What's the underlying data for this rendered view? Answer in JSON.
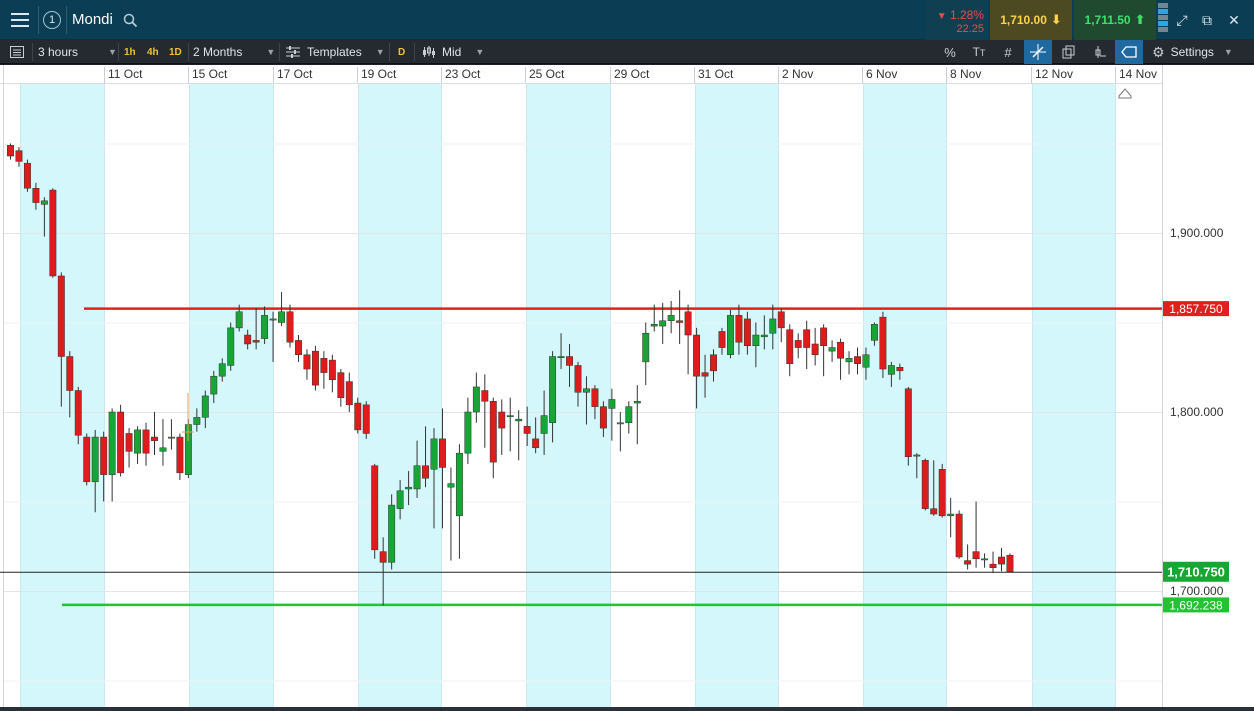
{
  "header": {
    "window_number": "1",
    "instrument": "Mondi",
    "change_percent": "1.28%",
    "change_abs": "22.25",
    "sell_price": "1,710.00",
    "buy_price": "1,711.50"
  },
  "toolbar": {
    "interval": "3 hours",
    "q1": "1h",
    "q2": "4h",
    "q3": "1D",
    "range": "2 Months",
    "templates": "Templates",
    "d_badge": "D",
    "price_type": "Mid",
    "settings": "Settings"
  },
  "colors": {
    "up": "#17a536",
    "down": "#e01b1b",
    "resistance": "#e02020",
    "support": "#22c233",
    "band": "#d4f7fb",
    "last_price_bg": "#18a632"
  },
  "chart_data": {
    "type": "candlestick",
    "x_labels": [
      "11 Oct",
      "15 Oct",
      "17 Oct",
      "19 Oct",
      "23 Oct",
      "25 Oct",
      "29 Oct",
      "31 Oct",
      "2 Nov",
      "6 Nov",
      "8 Nov",
      "12 Nov",
      "14 Nov"
    ],
    "y_ticks": [
      "1,900.000",
      "1,800.000",
      "1,700.000"
    ],
    "y_tick_values": [
      1900,
      1800,
      1700
    ],
    "ylim": [
      1650,
      1985
    ],
    "resistance": {
      "value": 1857.75,
      "label": "1,857.750"
    },
    "support": {
      "value": 1692.238,
      "label": "1,692.238"
    },
    "last_price": {
      "value": 1710.75,
      "label": "1,710.750"
    },
    "candles": [
      [
        1949,
        1943,
        1950,
        1941
      ],
      [
        1946,
        1940,
        1948,
        1937
      ],
      [
        1939,
        1925,
        1941,
        1923
      ],
      [
        1925,
        1917,
        1928,
        1913
      ],
      [
        1916,
        1918,
        1920,
        1898
      ],
      [
        1924,
        1876,
        1925,
        1875
      ],
      [
        1876,
        1831,
        1878,
        1803
      ],
      [
        1831,
        1812,
        1834,
        1797
      ],
      [
        1812,
        1787,
        1814,
        1782
      ],
      [
        1786,
        1761,
        1788,
        1759
      ],
      [
        1761,
        1786,
        1790,
        1744
      ],
      [
        1786,
        1765,
        1789,
        1750
      ],
      [
        1765,
        1800,
        1802,
        1750
      ],
      [
        1800,
        1766,
        1804,
        1764
      ],
      [
        1788,
        1778,
        1791,
        1769
      ],
      [
        1777,
        1790,
        1792,
        1771
      ],
      [
        1790,
        1777,
        1794,
        1770
      ],
      [
        1786,
        1784,
        1800,
        1776
      ],
      [
        1778,
        1780,
        1796,
        1770
      ],
      [
        1786,
        1786,
        1796,
        1779
      ],
      [
        1786,
        1766,
        1788,
        1762
      ],
      [
        1765,
        1793,
        1796,
        1763
      ],
      [
        1793,
        1797,
        1802,
        1789
      ],
      [
        1797,
        1809,
        1812,
        1791
      ],
      [
        1810,
        1820,
        1823,
        1805
      ],
      [
        1820,
        1827,
        1830,
        1817
      ],
      [
        1826,
        1847,
        1850,
        1823
      ],
      [
        1847,
        1856,
        1860,
        1845
      ],
      [
        1843,
        1838,
        1846,
        1835
      ],
      [
        1840,
        1839,
        1858,
        1835
      ],
      [
        1841,
        1854,
        1859,
        1838
      ],
      [
        1852,
        1852,
        1856,
        1828
      ],
      [
        1850,
        1856,
        1867,
        1848
      ],
      [
        1856,
        1839,
        1860,
        1836
      ],
      [
        1840,
        1832,
        1843,
        1828
      ],
      [
        1832,
        1824,
        1835,
        1818
      ],
      [
        1834,
        1815,
        1837,
        1812
      ],
      [
        1830,
        1822,
        1834,
        1813
      ],
      [
        1829,
        1818,
        1832,
        1811
      ],
      [
        1822,
        1808,
        1824,
        1803
      ],
      [
        1817,
        1804,
        1822,
        1800
      ],
      [
        1805,
        1790,
        1808,
        1788
      ],
      [
        1804,
        1788,
        1806,
        1785
      ],
      [
        1770,
        1723,
        1771,
        1718
      ],
      [
        1722,
        1716,
        1730,
        1692
      ],
      [
        1716,
        1748,
        1754,
        1712
      ],
      [
        1746,
        1756,
        1762,
        1740
      ],
      [
        1757,
        1758,
        1767,
        1748
      ],
      [
        1757,
        1770,
        1784,
        1752
      ],
      [
        1770,
        1763,
        1792,
        1758
      ],
      [
        1768,
        1785,
        1791,
        1735
      ],
      [
        1785,
        1769,
        1802,
        1735
      ],
      [
        1758,
        1760,
        1769,
        1717
      ],
      [
        1742,
        1777,
        1782,
        1718
      ],
      [
        1777,
        1800,
        1808,
        1771
      ],
      [
        1800,
        1814,
        1822,
        1794
      ],
      [
        1812,
        1806,
        1821,
        1780
      ],
      [
        1806,
        1772,
        1808,
        1763
      ],
      [
        1800,
        1791,
        1807,
        1776
      ],
      [
        1798,
        1798,
        1808,
        1778
      ],
      [
        1795,
        1796,
        1801,
        1773
      ],
      [
        1792,
        1788,
        1803,
        1781
      ],
      [
        1785,
        1780,
        1797,
        1777
      ],
      [
        1788,
        1798,
        1812,
        1776
      ],
      [
        1794,
        1831,
        1834,
        1783
      ],
      [
        1831,
        1831,
        1844,
        1824
      ],
      [
        1831,
        1826,
        1838,
        1814
      ],
      [
        1826,
        1811,
        1828,
        1803
      ],
      [
        1811,
        1813,
        1820,
        1793
      ],
      [
        1813,
        1803,
        1815,
        1796
      ],
      [
        1803,
        1791,
        1806,
        1786
      ],
      [
        1802,
        1807,
        1813,
        1784
      ],
      [
        1794,
        1794,
        1800,
        1778
      ],
      [
        1794,
        1803,
        1806,
        1788
      ],
      [
        1805,
        1806,
        1815,
        1782
      ],
      [
        1828,
        1844,
        1850,
        1815
      ],
      [
        1848,
        1849,
        1860,
        1845
      ],
      [
        1848,
        1851,
        1861,
        1838
      ],
      [
        1851,
        1854,
        1862,
        1844
      ],
      [
        1851,
        1850,
        1868,
        1838
      ],
      [
        1856,
        1843,
        1860,
        1821
      ],
      [
        1843,
        1820,
        1847,
        1802
      ],
      [
        1822,
        1820,
        1832,
        1808
      ],
      [
        1832,
        1823,
        1835,
        1817
      ],
      [
        1845,
        1836,
        1847,
        1832
      ],
      [
        1832,
        1854,
        1857,
        1830
      ],
      [
        1854,
        1839,
        1860,
        1832
      ],
      [
        1852,
        1837,
        1856,
        1832
      ],
      [
        1837,
        1843,
        1850,
        1825
      ],
      [
        1842,
        1843,
        1854,
        1835
      ],
      [
        1844,
        1852,
        1860,
        1835
      ],
      [
        1856,
        1847,
        1858,
        1839
      ],
      [
        1846,
        1827,
        1849,
        1820
      ],
      [
        1840,
        1836,
        1844,
        1830
      ],
      [
        1846,
        1836,
        1851,
        1824
      ],
      [
        1838,
        1832,
        1847,
        1826
      ],
      [
        1847,
        1837,
        1849,
        1820
      ],
      [
        1834,
        1836,
        1840,
        1828
      ],
      [
        1839,
        1830,
        1841,
        1818
      ],
      [
        1828,
        1830,
        1834,
        1821
      ],
      [
        1831,
        1827,
        1836,
        1821
      ],
      [
        1825,
        1832,
        1836,
        1818
      ],
      [
        1840,
        1849,
        1850,
        1837
      ],
      [
        1853,
        1824,
        1856,
        1819
      ],
      [
        1821,
        1826,
        1828,
        1814
      ],
      [
        1825,
        1823,
        1827,
        1818
      ],
      [
        1813,
        1775,
        1814,
        1770
      ],
      [
        1776,
        1776,
        1777,
        1763
      ],
      [
        1773,
        1746,
        1774,
        1745
      ],
      [
        1746,
        1743,
        1773,
        1742
      ],
      [
        1768,
        1742,
        1771,
        1741
      ],
      [
        1742,
        1743,
        1752,
        1730
      ],
      [
        1743,
        1719,
        1745,
        1718
      ],
      [
        1717,
        1715,
        1726,
        1712
      ],
      [
        1722,
        1718,
        1750,
        1713
      ],
      [
        1718,
        1718,
        1721,
        1713
      ],
      [
        1715,
        1713,
        1722,
        1710
      ],
      [
        1719,
        1715,
        1724,
        1711
      ],
      [
        1720,
        1710.75,
        1721,
        1710.75
      ]
    ]
  }
}
